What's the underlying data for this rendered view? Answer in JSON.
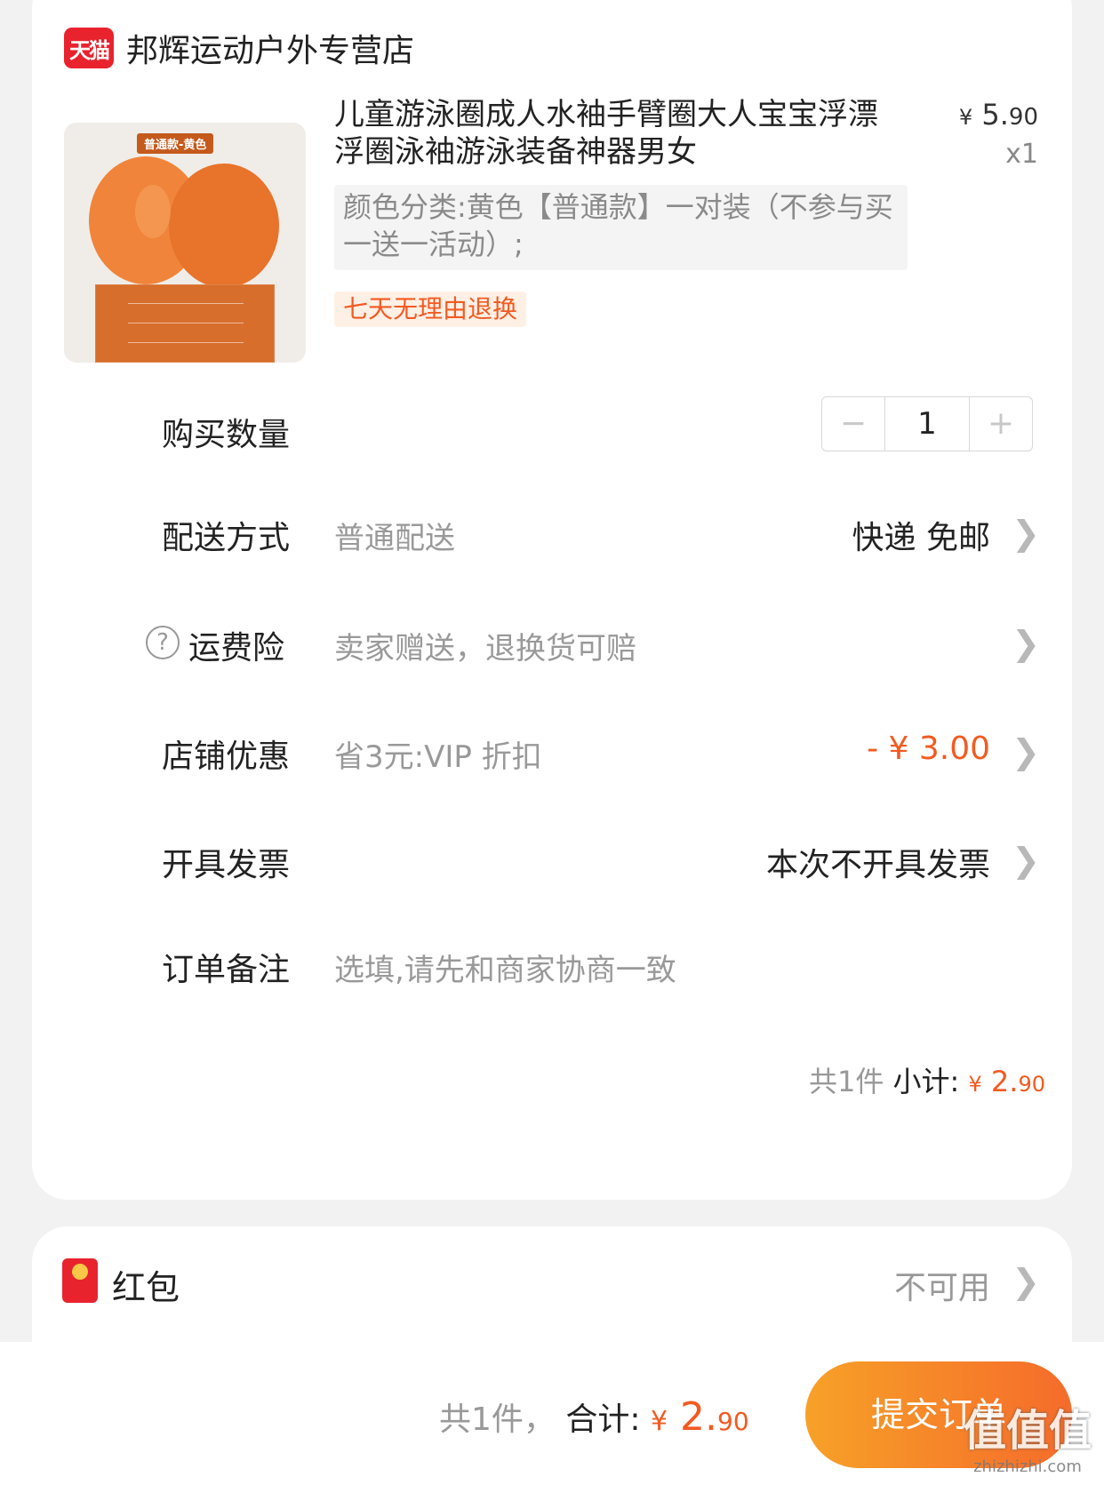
{
  "store": {
    "logo_text": "天猫",
    "name": "邦辉运动户外专营店"
  },
  "product": {
    "image_tag": "普通款-黄色",
    "title": "儿童游泳圈成人水袖手臂圈大人宝宝浮漂浮圈泳袖游泳装备神器男女",
    "price_yen": "¥",
    "price_int": "5.",
    "price_dec": "90",
    "qty": "x1",
    "spec": "颜色分类:黄色【普通款】一对装（不参与买一送一活动）;",
    "badge": "七天无理由退换"
  },
  "rows": {
    "qty_label": "购买数量",
    "qty_minus": "−",
    "qty_value": "1",
    "qty_plus": "+",
    "delivery_label": "配送方式",
    "delivery_value": "普通配送",
    "delivery_right": "快递 免邮",
    "insurance_label": "运费险",
    "insurance_value": "卖家赠送，退换货可赔",
    "discount_label": "店铺优惠",
    "discount_value": "省3元:VIP 折扣",
    "discount_right": "- ¥ 3.00",
    "invoice_label": "开具发票",
    "invoice_right": "本次不开具发票",
    "note_label": "订单备注",
    "note_placeholder": "选填,请先和商家协商一致"
  },
  "subtotal": {
    "count": "共1件",
    "label": "小计:",
    "yen": "¥",
    "int": "2.",
    "dec": "90"
  },
  "redpacket": {
    "label": "红包",
    "status": "不可用"
  },
  "footer": {
    "count": "共1件，",
    "label": "合计:",
    "yen": "¥",
    "int": "2.",
    "dec": "90",
    "submit": "提交订单"
  },
  "watermark": {
    "text": "值值值",
    "url": "zhizhizhi.com"
  },
  "colors": {
    "accent": "#f35a20",
    "tmall": "#e8232e",
    "submit_from": "#f7a128",
    "submit_to": "#f56b2a"
  }
}
